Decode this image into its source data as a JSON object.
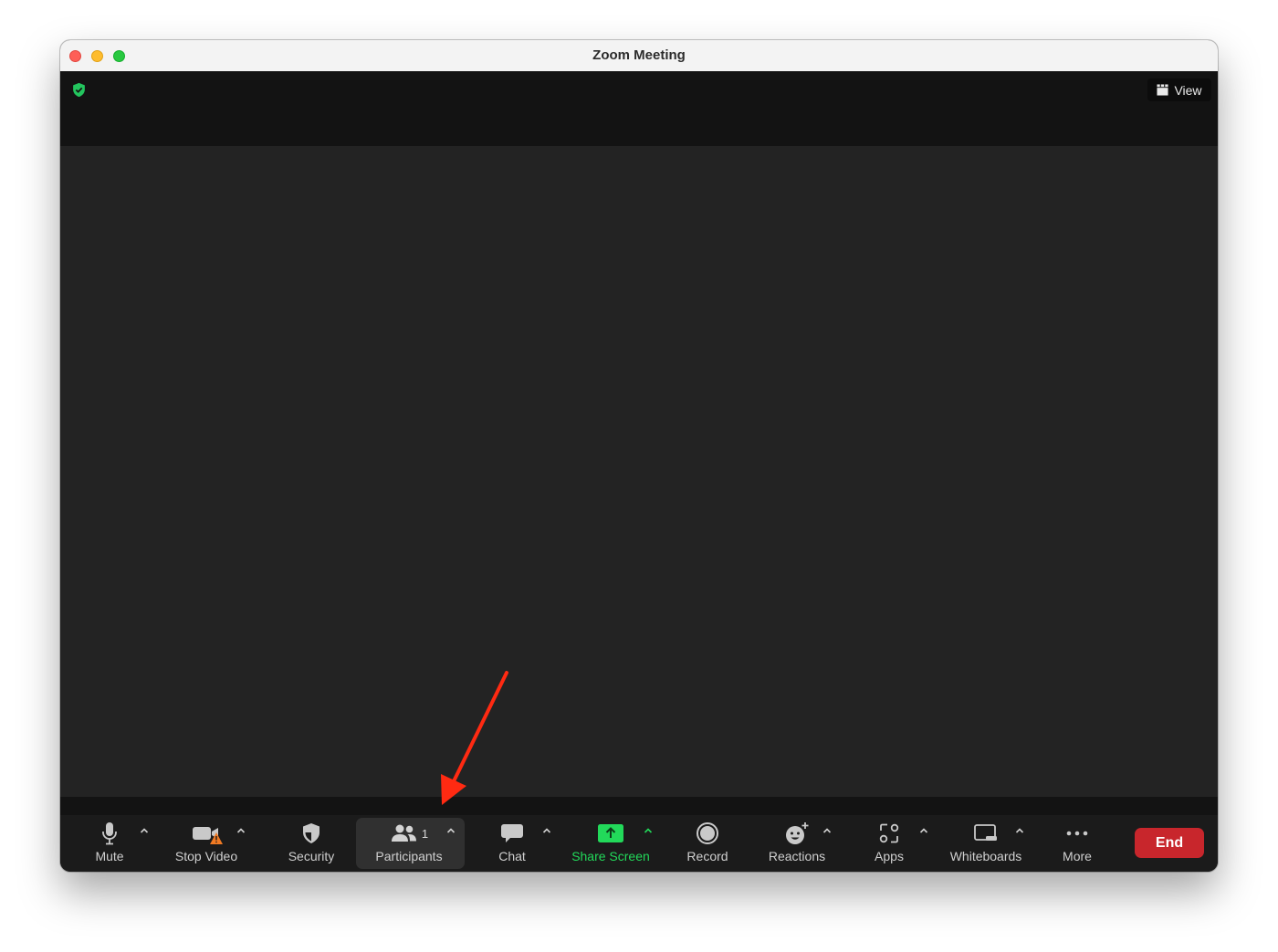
{
  "window": {
    "title": "Zoom Meeting"
  },
  "topbar": {
    "view_label": "View"
  },
  "toolbar": {
    "mute": "Mute",
    "stop_video": "Stop Video",
    "security": "Security",
    "participants": "Participants",
    "participants_count": "1",
    "chat": "Chat",
    "share_screen": "Share Screen",
    "record": "Record",
    "reactions": "Reactions",
    "apps": "Apps",
    "whiteboards": "Whiteboards",
    "more": "More",
    "end": "End"
  },
  "colors": {
    "share_green": "#22d95a",
    "end_red": "#c8262c",
    "encryption_green": "#23c55e",
    "warning_orange": "#f07a23",
    "annotation_arrow": "#ff2a12"
  }
}
